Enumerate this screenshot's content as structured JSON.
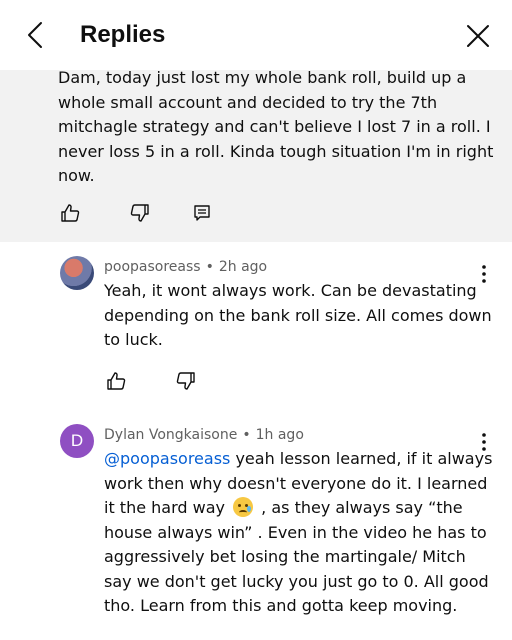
{
  "header": {
    "title": "Replies",
    "back_icon": "chevron-left-icon",
    "close_icon": "close-icon"
  },
  "parent_comment": {
    "text": "Dam, today just lost my whole bank roll, build up a whole small account and decided to try the 7th mitchagle strategy and can't believe I lost 7 in a roll. I never loss 5 in a roll. Kinda tough situation I'm in right now.",
    "background": "#f2f2f2",
    "actions": [
      "thumbs-up-icon",
      "thumbs-down-icon",
      "reply-icon"
    ]
  },
  "replies": [
    {
      "author": "poopasoreass",
      "separator": "•",
      "time": "2h ago",
      "text": "Yeah, it wont always work. Can be devastating depending on the bank roll size. All comes down to luck.",
      "actions": [
        "thumbs-up-icon",
        "thumbs-down-icon"
      ]
    },
    {
      "author": "Dylan Vongkaisone",
      "separator": "•",
      "time": "1h ago",
      "avatar_letter": "D",
      "avatar_color": "#8f4fc2",
      "mention": "@poopasoreass",
      "text_before_emoji": " yeah lesson learned, if it always work then why doesn't everyone do it. I learned it the hard way ",
      "text_after_emoji": " , as they always say “the house always win” . Even in the video he has to aggressively bet losing the martingale/ Mitch say we don't get lucky you just go to 0. All good tho. Learn from this and gotta keep moving."
    }
  ],
  "colors": {
    "mention": "#065fd4",
    "meta": "#606060",
    "text": "#0f0f0f"
  }
}
